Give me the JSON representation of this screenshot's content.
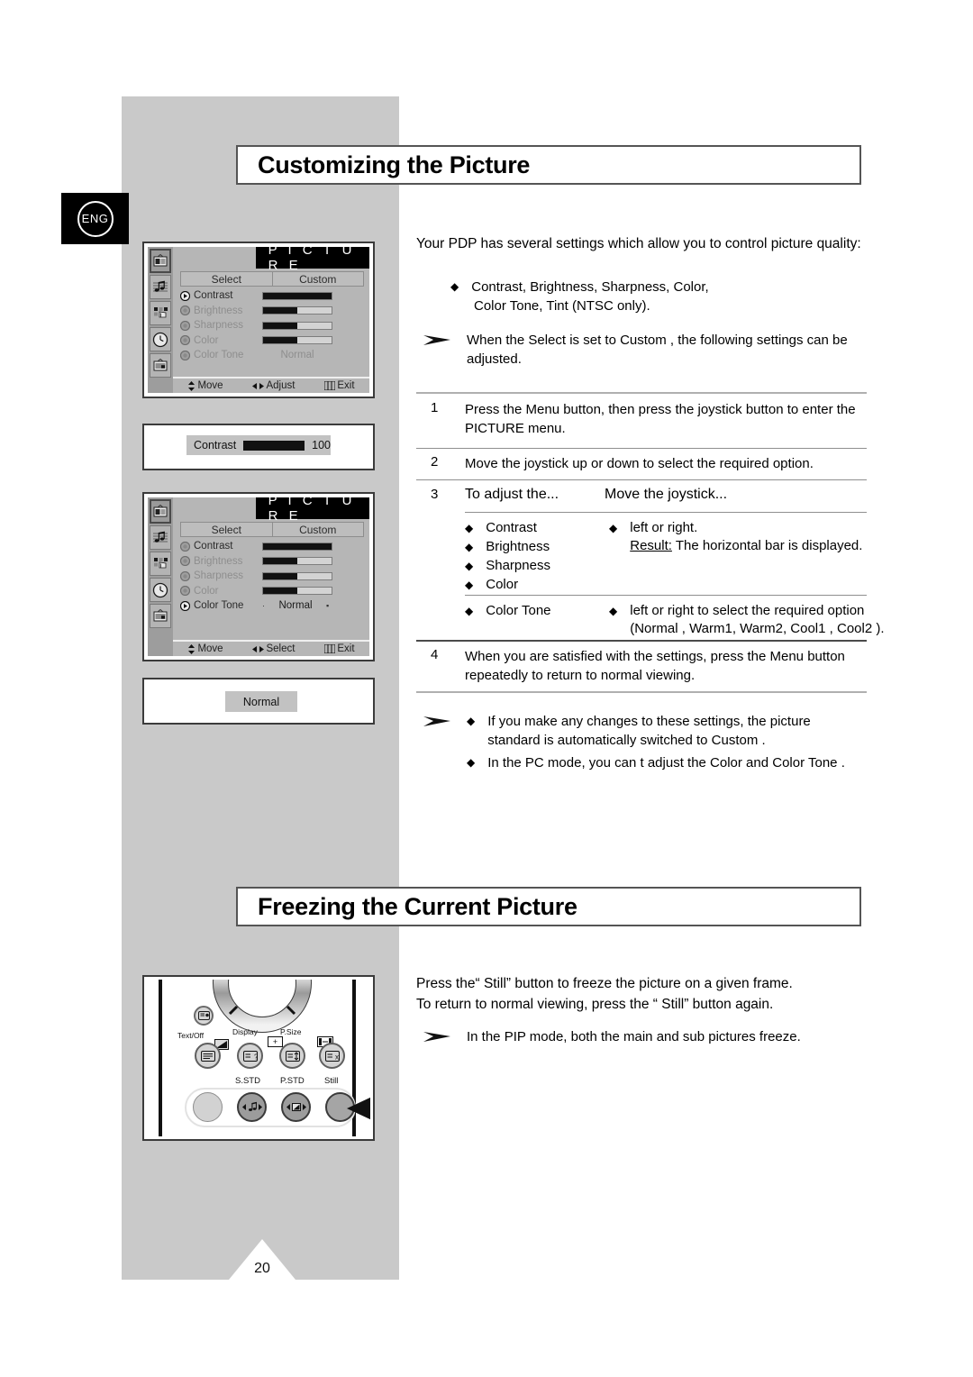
{
  "page": {
    "number": "20",
    "language_badge": "ENG"
  },
  "sections": {
    "customizing": {
      "title": "Customizing the Picture"
    },
    "freezing": {
      "title": "Freezing the Current Picture"
    }
  },
  "intro": {
    "paragraph": "Your PDP has several settings which allow you to control picture quality:",
    "bullets": [
      "Contrast, Brightness, Sharpness, Color,",
      "Color Tone, Tint       (NTSC only)."
    ],
    "note": "When the Select   is set to Custom , the following settings can be adjusted."
  },
  "steps": [
    {
      "num": "1",
      "text": "Press the Menu button, then press the joystick button to enter the PICTURE menu."
    },
    {
      "num": "2",
      "text": "Move the joystick up or down to select the required option."
    },
    {
      "num": "3",
      "text": "To adjust the..."
    },
    {
      "num": "4",
      "text": "When you are satisfied with the settings, press the Menu button repeatedly to return to normal viewing."
    }
  ],
  "step3_table": {
    "col1_header": "To adjust the...",
    "col2_header": "Move the joystick...",
    "group1": {
      "options": [
        "Contrast",
        "Brightness",
        "Sharpness",
        "Color"
      ],
      "action": "left or right.",
      "result_label": "Result:",
      "result_text": "The horizontal bar is displayed."
    },
    "group2": {
      "option": "Color Tone",
      "action_line1": "left or right to select the required option",
      "action_line2": "(Normal , Warm1, Warm2, Cool1 , Cool2 )."
    }
  },
  "final_note": {
    "bullets": [
      "If you make any changes to these settings, the picture standard is automatically switched to Custom .",
      "In the PC mode, you can t adjust the Color   and Color Tone ."
    ]
  },
  "freezing_text": {
    "line1": "Press the“ Still”  button to freeze the picture on a given frame.",
    "line2": "To return to normal viewing, press the “ Still”  button again.",
    "note": "In the PIP mode, both the main and sub pictures freeze."
  },
  "osd1": {
    "title": "P I C T U R E",
    "select_label": "Select",
    "select_value": "Custom",
    "rows": [
      {
        "label": "Contrast",
        "dim": false,
        "active": true,
        "type": "bar",
        "fill": 100
      },
      {
        "label": "Brightness",
        "dim": true,
        "active": false,
        "type": "bar",
        "fill": 50
      },
      {
        "label": "Sharpness",
        "dim": true,
        "active": false,
        "type": "bar",
        "fill": 50
      },
      {
        "label": "Color",
        "dim": true,
        "active": false,
        "type": "bar",
        "fill": 50
      },
      {
        "label": "Color Tone",
        "dim": true,
        "active": false,
        "type": "text",
        "value": "Normal"
      }
    ],
    "footer": {
      "move": "Move",
      "middle": "Adjust",
      "exit": "Exit"
    }
  },
  "osd2": {
    "title": "P I C T U R E",
    "select_label": "Select",
    "select_value": "Custom",
    "rows": [
      {
        "label": "Contrast",
        "dim": false,
        "active": false,
        "type": "bar",
        "fill": 100
      },
      {
        "label": "Brightness",
        "dim": true,
        "active": false,
        "type": "bar",
        "fill": 50
      },
      {
        "label": "Sharpness",
        "dim": true,
        "active": false,
        "type": "bar",
        "fill": 50
      },
      {
        "label": "Color",
        "dim": true,
        "active": false,
        "type": "bar",
        "fill": 50
      },
      {
        "label": "Color Tone",
        "dim": false,
        "active": true,
        "type": "text",
        "value": "Normal"
      }
    ],
    "footer": {
      "move": "Move",
      "middle": "Select",
      "exit": "Exit"
    }
  },
  "contrast_popup": {
    "label": "Contrast",
    "value": "100",
    "fill": 100
  },
  "normal_popup": {
    "label": "Normal"
  },
  "remote": {
    "labels_top": [
      "Text/Off",
      "Display",
      "P.Size"
    ],
    "labels_bottom": [
      "S.STD",
      "P.STD",
      "Still"
    ]
  },
  "colors": {
    "band_gray": "#c9c9c9",
    "osd_bg": "#b6b6b6",
    "osd_side": "#9d9d9d",
    "accent_black": "#000000"
  }
}
